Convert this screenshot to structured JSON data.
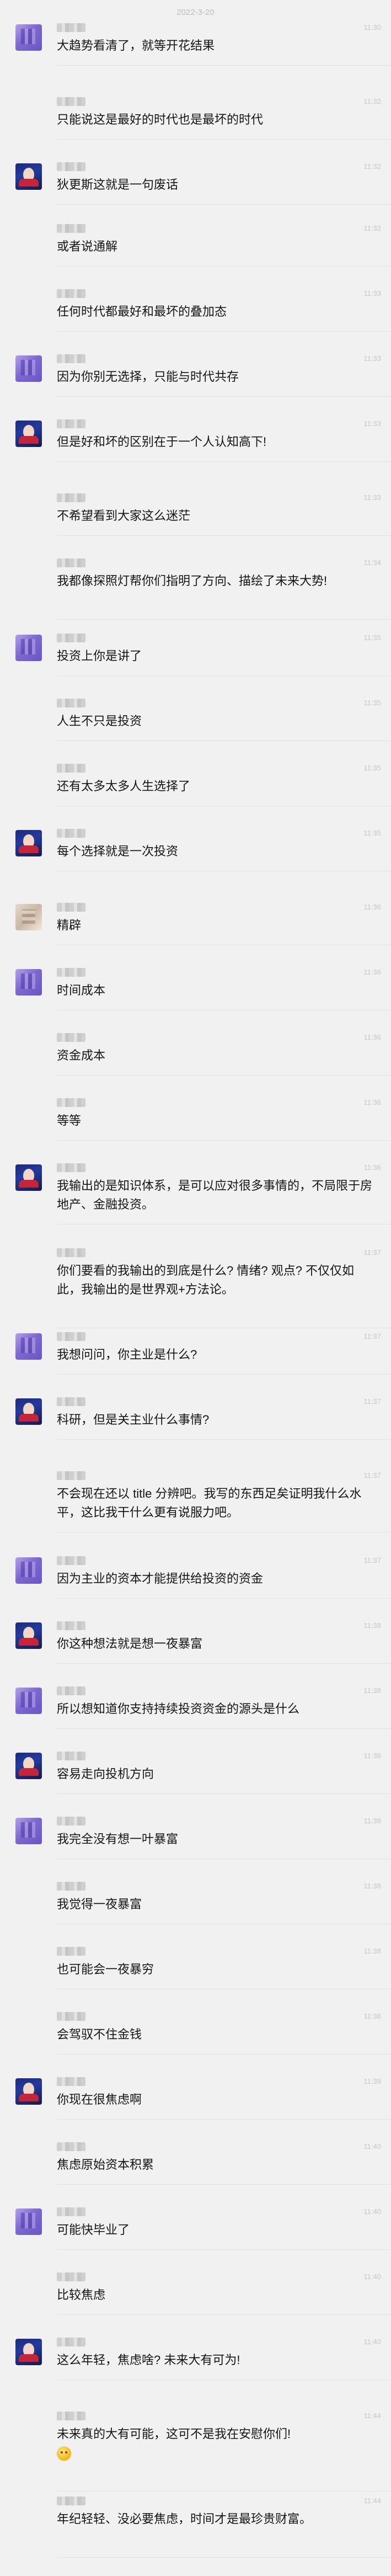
{
  "chat": {
    "date": "2022-3-20",
    "messages": [
      {
        "avatar": "purple",
        "time": "11:30",
        "text": "大趋势看清了，就等开花结果"
      },
      {
        "avatar": "blank",
        "time": "11:32",
        "text": "只能说这是最好的时代也是最坏的时代"
      },
      {
        "avatar": "anime",
        "time": "11:32",
        "text": "狄更斯这就是一句废话"
      },
      {
        "avatar": "blank",
        "time": "11:32",
        "text": "或者说通解"
      },
      {
        "avatar": "blank",
        "time": "11:33",
        "text": "任何时代都最好和最坏的叠加态"
      },
      {
        "avatar": "purple",
        "time": "11:33",
        "text": "因为你别无选择，只能与时代共存"
      },
      {
        "avatar": "anime",
        "time": "11:33",
        "text": "但是好和坏的区别在于一个人认知高下!"
      },
      {
        "avatar": "blank",
        "time": "11:33",
        "text": "不希望看到大家这么迷茫"
      },
      {
        "avatar": "blank",
        "time": "11:34",
        "text": "我都像探照灯帮你们指明了方向、描绘了未来大势!"
      },
      {
        "avatar": "purple",
        "time": "11:35",
        "text": "投资上你是讲了"
      },
      {
        "avatar": "blank",
        "time": "11:35",
        "text": "人生不只是投资"
      },
      {
        "avatar": "blank",
        "time": "11:35",
        "text": "还有太多太多人生选择了"
      },
      {
        "avatar": "anime",
        "time": "11:35",
        "text": "每个选择就是一次投资"
      },
      {
        "avatar": "photo",
        "time": "11:36",
        "text": "精辟"
      },
      {
        "avatar": "purple",
        "time": "11:36",
        "text": "时间成本"
      },
      {
        "avatar": "blank",
        "time": "11:36",
        "text": "资金成本"
      },
      {
        "avatar": "blank",
        "time": "11:36",
        "text": "等等"
      },
      {
        "avatar": "anime",
        "time": "11:36",
        "text": "我输出的是知识体系，是可以应对很多事情的，不局限于房地产、金融投资。"
      },
      {
        "avatar": "blank",
        "time": "11:37",
        "text": "你们要看的我输出的到底是什么? 情绪? 观点? 不仅仅如此，我输出的是世界观+方法论。"
      },
      {
        "avatar": "purple",
        "time": "11:37",
        "text": "我想问问，你主业是什么?"
      },
      {
        "avatar": "anime",
        "time": "11:37",
        "text": "科研，但是关主业什么事情?"
      },
      {
        "avatar": "blank",
        "time": "11:37",
        "text": "不会现在还以 title 分辨吧。我写的东西足矣证明我什么水平，这比我干什么更有说服力吧。"
      },
      {
        "avatar": "purple",
        "time": "11:37",
        "text": "因为主业的资本才能提供给投资的资金"
      },
      {
        "avatar": "anime",
        "time": "11:38",
        "text": "你这种想法就是想一夜暴富"
      },
      {
        "avatar": "purple",
        "time": "11:38",
        "text": "所以想知道你支持持续投资资金的源头是什么"
      },
      {
        "avatar": "anime",
        "time": "11:38",
        "text": "容易走向投机方向"
      },
      {
        "avatar": "purple",
        "time": "11:38",
        "text": "我完全没有想一叶暴富"
      },
      {
        "avatar": "blank",
        "time": "11:38",
        "text": "我觉得一夜暴富"
      },
      {
        "avatar": "blank",
        "time": "11:38",
        "text": "也可能会一夜暴穷"
      },
      {
        "avatar": "blank",
        "time": "11:38",
        "text": "会驾驭不住金钱"
      },
      {
        "avatar": "anime",
        "time": "11:39",
        "text": "你现在很焦虑啊"
      },
      {
        "avatar": "blank",
        "time": "11:40",
        "text": "焦虑原始资本积累"
      },
      {
        "avatar": "purple",
        "time": "11:40",
        "text": "可能快毕业了"
      },
      {
        "avatar": "blank",
        "time": "11:40",
        "text": "比较焦虑"
      },
      {
        "avatar": "anime",
        "time": "11:40",
        "text": "这么年轻，焦虑啥? 未来大有可为!"
      },
      {
        "avatar": "blank",
        "time": "11:44",
        "text": "未来真的大有可能，这可不是我在安慰你们!",
        "emoji": "smile-emoji"
      },
      {
        "avatar": "blank",
        "time": "11:44",
        "text": "年纪轻轻、没必要焦虑，时间才是最珍贵财富。"
      }
    ]
  }
}
